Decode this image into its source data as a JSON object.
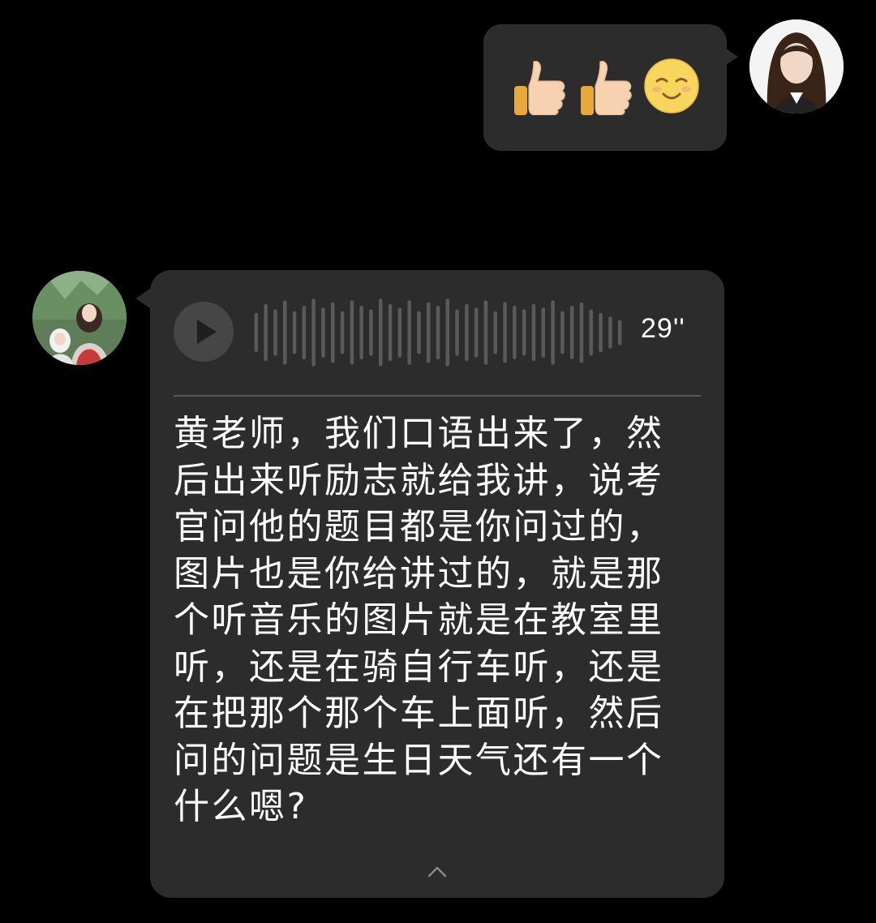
{
  "outgoing_message": {
    "emojis": [
      {
        "name": "thumbs-up"
      },
      {
        "name": "thumbs-up"
      },
      {
        "name": "smiling-face"
      }
    ]
  },
  "voice_message": {
    "duration": "29''",
    "transcript": "黄老师，我们口语出来了，然后出来听励志就给我讲，说考官问他的题目都是你问过的，图片也是你给讲过的，就是那个听音乐的图片就是在教室里听，还是在骑自行车听，还是在把那个那个车上面听，然后问的问题是生日天气还有一个什么嗯?",
    "waveform_levels": [
      0.55,
      0.8,
      0.65,
      0.9,
      0.6,
      0.75,
      0.95,
      0.7,
      0.85,
      0.6,
      0.9,
      0.75,
      0.65,
      0.95,
      0.8,
      0.7,
      0.9,
      0.6,
      0.85,
      0.75,
      0.95,
      0.65,
      0.8,
      0.7,
      0.9,
      0.6,
      0.85,
      0.75,
      0.65,
      0.8,
      0.7,
      0.9,
      0.6,
      0.75,
      0.85,
      0.65,
      0.55,
      0.45,
      0.35
    ]
  },
  "colors": {
    "background": "#000000",
    "bubble": "#2c2c2c",
    "text": "#ffffff",
    "waveform": "#5a5a5a"
  }
}
